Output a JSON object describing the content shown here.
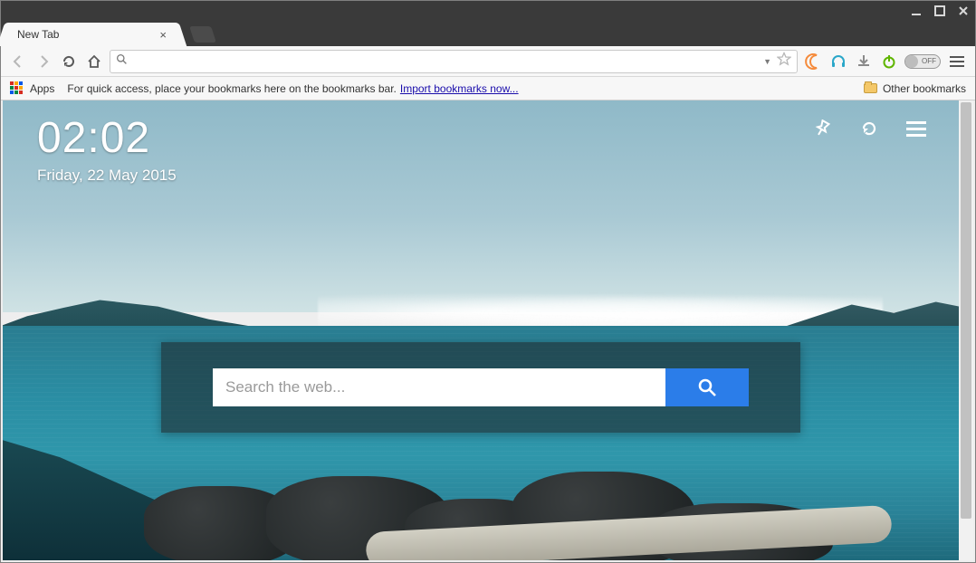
{
  "window": {
    "tab_title": "New Tab"
  },
  "toolbar": {
    "omnibox_value": "",
    "toggle_label": "OFF"
  },
  "bookmarks_bar": {
    "apps_label": "Apps",
    "hint_text": "For quick access, place your bookmarks here on the bookmarks bar.",
    "import_link": "Import bookmarks now...",
    "other_label": "Other bookmarks"
  },
  "newtab": {
    "clock_time": "02:02",
    "clock_date": "Friday,  22  May  2015",
    "search_placeholder": "Search the web..."
  }
}
